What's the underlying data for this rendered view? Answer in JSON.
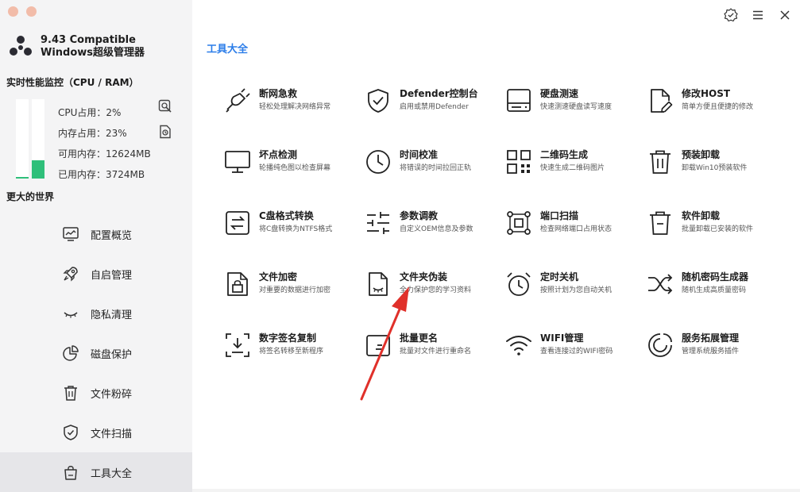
{
  "app": {
    "title_line1": "9.43 Compatible",
    "title_line2": "Windows超级管理器"
  },
  "monitor": {
    "title": "实时性能监控（CPU / RAM）",
    "cpu_label": "CPU占用：2%",
    "mem_label": "内存占用：23%",
    "available_label": "可用内存：12624MB",
    "used_label": "已用内存：3724MB",
    "cpu_percent": 2,
    "mem_percent": 23,
    "bar_color": "#2fbf7a"
  },
  "section_world": "更大的世界",
  "nav": {
    "items": [
      {
        "label": "配置概览",
        "icon": "monitor-icon"
      },
      {
        "label": "自启管理",
        "icon": "rocket-icon"
      },
      {
        "label": "隐私清理",
        "icon": "eye-closed-icon"
      },
      {
        "label": "磁盘保护",
        "icon": "pie-chart-icon"
      },
      {
        "label": "文件粉碎",
        "icon": "trash-icon"
      },
      {
        "label": "文件扫描",
        "icon": "shield-check-icon"
      },
      {
        "label": "工具大全",
        "icon": "bag-icon",
        "active": true
      }
    ]
  },
  "main": {
    "title": "工具大全",
    "accent": "#2b7de9"
  },
  "tools": [
    {
      "name": "断网急救",
      "desc": "轻松处理解决网络异常",
      "icon": "plug-icon"
    },
    {
      "name": "Defender控制台",
      "desc": "启用或禁用Defender",
      "icon": "shield-check-icon"
    },
    {
      "name": "硬盘测速",
      "desc": "快速测速硬盘读写速度",
      "icon": "harddisk-icon"
    },
    {
      "name": "修改HOST",
      "desc": "简单方便且便捷的修改",
      "icon": "file-edit-icon"
    },
    {
      "name": "坏点检测",
      "desc": "轮播纯色图以检查屏幕",
      "icon": "monitor-icon"
    },
    {
      "name": "时间校准",
      "desc": "将错误的时间拉回正轨",
      "icon": "clock-icon"
    },
    {
      "name": "二维码生成",
      "desc": "快速生成二维码图片",
      "icon": "qrcode-icon"
    },
    {
      "name": "预装卸载",
      "desc": "卸载Win10预装软件",
      "icon": "trash-icon"
    },
    {
      "name": "C盘格式转换",
      "desc": "将C盘转换为NTFS格式",
      "icon": "convert-icon"
    },
    {
      "name": "参数调教",
      "desc": "自定义OEM信息及参数",
      "icon": "sliders-icon"
    },
    {
      "name": "端口扫描",
      "desc": "检查网络端口占用状态",
      "icon": "port-scan-icon"
    },
    {
      "name": "软件卸载",
      "desc": "批量卸载已安装的软件",
      "icon": "trash-icon"
    },
    {
      "name": "文件加密",
      "desc": "对重要的数据进行加密",
      "icon": "file-lock-icon"
    },
    {
      "name": "文件夹伪装",
      "desc": "全力保护您的学习资料",
      "icon": "file-disguise-icon"
    },
    {
      "name": "定时关机",
      "desc": "按照计划为您自动关机",
      "icon": "alarm-clock-icon"
    },
    {
      "name": "随机密码生成器",
      "desc": "随机生成高质量密码",
      "icon": "shuffle-icon"
    },
    {
      "name": "数字签名复制",
      "desc": "将签名转移至新程序",
      "icon": "signature-copy-icon"
    },
    {
      "name": "批量更名",
      "desc": "批量对文件进行重命名",
      "icon": "rename-icon"
    },
    {
      "name": "WIFI管理",
      "desc": "查看连接过的WIFI密码",
      "icon": "wifi-icon"
    },
    {
      "name": "服务拓展管理",
      "desc": "管理系统服务插件",
      "icon": "service-icon"
    }
  ],
  "annotation_color": "#e0302a"
}
